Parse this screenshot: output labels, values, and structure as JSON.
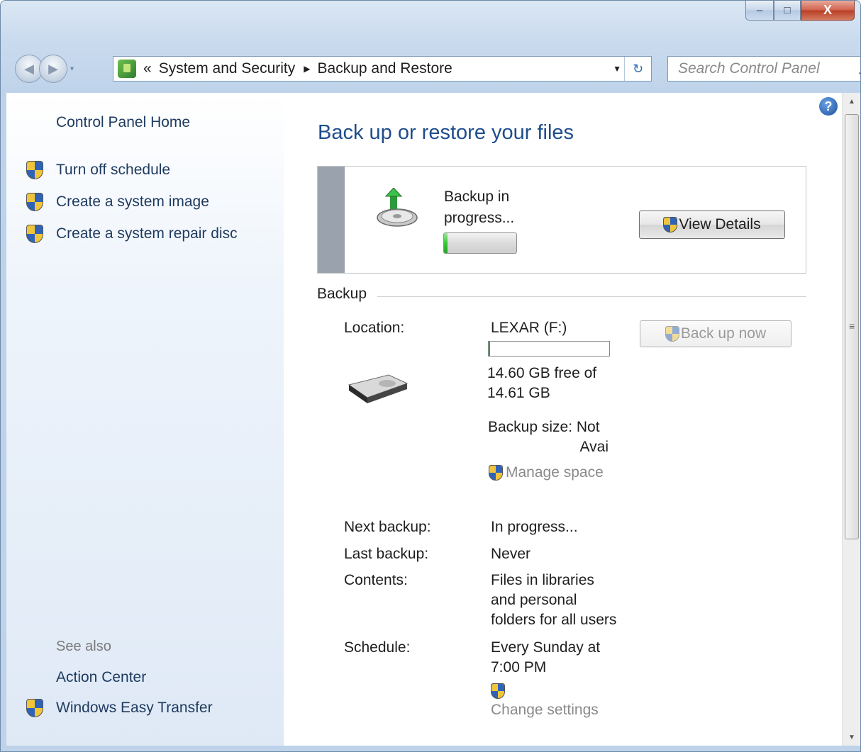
{
  "window": {
    "caption_buttons": {
      "minimize": "–",
      "maximize": "□",
      "close": "X"
    }
  },
  "nav": {
    "back_glyph": "◀",
    "forward_glyph": "▶",
    "history_glyph": "▾",
    "breadcrumb_overflow": "«",
    "breadcrumb": [
      "System and Security",
      "Backup and Restore"
    ],
    "separator": "▶",
    "dropdown_glyph": "▼",
    "refresh_glyph": "↻",
    "search_placeholder": "Search Control Panel"
  },
  "sidebar": {
    "home": "Control Panel Home",
    "tasks": [
      {
        "label": "Turn off schedule",
        "icon": "uac-shield-icon"
      },
      {
        "label": "Create a system image",
        "icon": "uac-shield-icon"
      },
      {
        "label": "Create a system repair disc",
        "icon": "uac-shield-icon"
      }
    ],
    "see_also_heading": "See also",
    "see_also": [
      {
        "label": "Action Center"
      },
      {
        "label": "Windows Easy Transfer",
        "icon": "uac-shield-icon"
      }
    ]
  },
  "main": {
    "help_glyph": "?",
    "title": "Back up or restore your files",
    "status": {
      "text_line1": "Backup in",
      "text_line2": "progress...",
      "progress_fraction": 0.05,
      "view_details_label": "View Details"
    },
    "backup_section": {
      "heading": "Backup",
      "location_label": "Location:",
      "location_value": "LEXAR (F:)",
      "disk_used_fraction": 0.01,
      "free_space_line1": "14.60 GB free of",
      "free_space_line2": "14.61 GB",
      "backup_size_line1": "Backup size: Not",
      "backup_size_line2": "Avai",
      "manage_space_label": "Manage space",
      "back_up_now_label": "Back up now",
      "rows": [
        {
          "label": "Next backup:",
          "value": "In progress..."
        },
        {
          "label": "Last backup:",
          "value": "Never"
        },
        {
          "label": "Contents:",
          "value_lines": [
            "Files in libraries",
            "and personal",
            "folders for all users"
          ]
        },
        {
          "label": "Schedule:",
          "value_lines": [
            "Every Sunday at",
            "7:00 PM"
          ]
        }
      ],
      "change_settings_label": "Change settings"
    }
  },
  "scrollbar": {
    "up_glyph": "▲",
    "down_glyph": "▼",
    "grip_glyph": "≡"
  },
  "colors": {
    "link": "#1e3a5f",
    "title": "#1e4d8c",
    "disabled_text": "#8a8a8a",
    "progress_green": "#37c63a"
  }
}
